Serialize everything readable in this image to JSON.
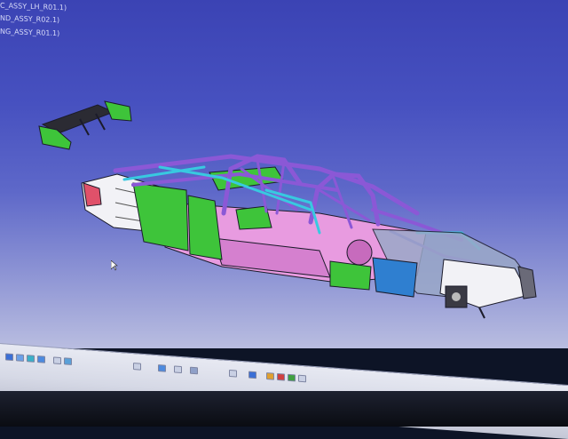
{
  "viewport": {
    "background_top": "#3b43b4",
    "background_bottom": "#b9bde0"
  },
  "tree": {
    "items": [
      "C_ASSY_LH_R01.1)",
      "ND_ASSY_R02.1)",
      "NG_ASSY_R01.1)"
    ]
  },
  "model": {
    "colors": {
      "frame_purple": "#8b58d6",
      "panel_pink": "#e89be0",
      "panel_green": "#3ec43a",
      "tube_cyan": "#38c9e0",
      "panel_white": "#f2f2f6",
      "outline": "#1b1b2a"
    }
  },
  "toolbar": {
    "button_icons": [
      "select-icon",
      "snap-icon",
      "view-icon",
      "zoom-icon",
      "pan-icon",
      "fit-all-icon",
      "rotate-icon",
      "normal-view-icon",
      "iso-view-icon",
      "shading-icon",
      "hide-show-icon",
      "measure-icon",
      "section-icon",
      "render-icon",
      "color-icon",
      "materials-icon"
    ]
  }
}
